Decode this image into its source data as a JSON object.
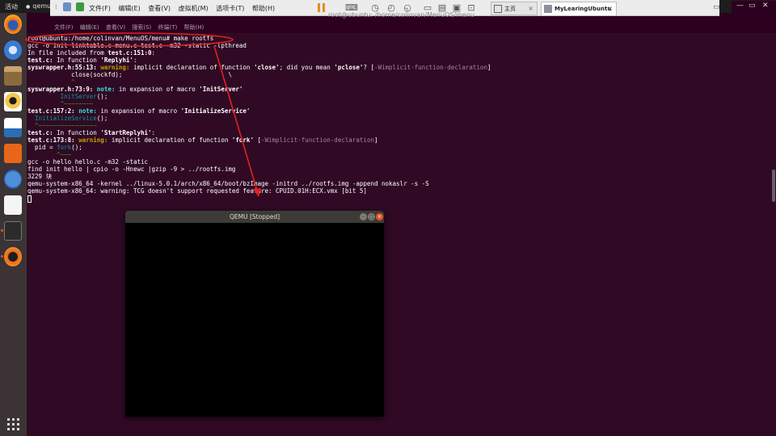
{
  "top_panel": {
    "activities": "活动",
    "app_name": "qemu-sy"
  },
  "vm_menu": {
    "items": [
      "文件(F)",
      "编辑(E)",
      "查看(V)",
      "虚拟机(M)",
      "选项卡(T)",
      "帮助(H)"
    ]
  },
  "tabs": [
    {
      "label": "主页"
    },
    {
      "label": "MyLearingUbuntu"
    }
  ],
  "terminal": {
    "title": "root@ubuntu: /home/colinvan/MenuOS/menu",
    "menu": [
      "文件(F)",
      "编辑(E)",
      "查看(V)",
      "搜索(S)",
      "终端(T)",
      "帮助(H)"
    ],
    "lines": [
      {
        "segs": [
          {
            "t": "root@ubuntu:/home/colinvan/MenuOS/menu# make rootfs"
          }
        ]
      },
      {
        "segs": [
          {
            "t": "gcc -o init linktable.c menu.c test.c -m32 -static -lpthread"
          }
        ]
      },
      {
        "segs": [
          {
            "t": "In file included from "
          },
          {
            "t": "test.c:151:0",
            "c": "b"
          },
          {
            "t": ":"
          }
        ]
      },
      {
        "segs": [
          {
            "t": "test.c:",
            "c": "b"
          },
          {
            "t": " In function "
          },
          {
            "t": "'Replyhi'",
            "c": "b"
          },
          {
            "t": ":"
          }
        ]
      },
      {
        "segs": [
          {
            "t": "syswrapper.h:55:13: ",
            "c": "b"
          },
          {
            "t": "warning: ",
            "c": "w"
          },
          {
            "t": "implicit declaration of function "
          },
          {
            "t": "'close'",
            "c": "b"
          },
          {
            "t": "; did you mean "
          },
          {
            "t": "'pclose'",
            "c": "b"
          },
          {
            "t": "? ["
          },
          {
            "t": "-Wimplicit-function-declaration",
            "c": "m"
          },
          {
            "t": "]"
          }
        ]
      },
      {
        "segs": [
          {
            "t": "            close(sockfd);                             \\"
          }
        ]
      },
      {
        "segs": [
          {
            "t": "            ^",
            "c": "g"
          }
        ]
      },
      {
        "segs": [
          {
            "t": "syswrapper.h:73:9: ",
            "c": "b"
          },
          {
            "t": "note: ",
            "c": "n"
          },
          {
            "t": "in expansion of macro "
          },
          {
            "t": "'InitServer'",
            "c": "b"
          }
        ]
      },
      {
        "segs": [
          {
            "t": "         "
          },
          {
            "t": "InitServer",
            "c": "c"
          },
          {
            "t": "();"
          }
        ]
      },
      {
        "segs": [
          {
            "t": "         ^~~~~~~~~",
            "c": "g"
          }
        ]
      },
      {
        "segs": [
          {
            "t": "test.c:157:2: ",
            "c": "b"
          },
          {
            "t": "note: ",
            "c": "n"
          },
          {
            "t": "in expansion of macro "
          },
          {
            "t": "'InitializeService'",
            "c": "b"
          }
        ]
      },
      {
        "segs": [
          {
            "t": "  "
          },
          {
            "t": "InitializeService",
            "c": "c"
          },
          {
            "t": "();"
          }
        ]
      },
      {
        "segs": [
          {
            "t": "  ^~~~~~~~~~~~~~~~~",
            "c": "g"
          }
        ]
      },
      {
        "segs": [
          {
            "t": "test.c:",
            "c": "b"
          },
          {
            "t": " In function "
          },
          {
            "t": "'StartReplyhi'",
            "c": "b"
          },
          {
            "t": ":"
          }
        ]
      },
      {
        "segs": [
          {
            "t": "test.c:173:8: ",
            "c": "b"
          },
          {
            "t": "warning: ",
            "c": "w"
          },
          {
            "t": "implicit declaration of function "
          },
          {
            "t": "'fork'",
            "c": "b"
          },
          {
            "t": " ["
          },
          {
            "t": "-Wimplicit-function-declaration",
            "c": "m"
          },
          {
            "t": "]"
          }
        ]
      },
      {
        "segs": [
          {
            "t": "  pid = "
          },
          {
            "t": "fork",
            "c": "c"
          },
          {
            "t": "();"
          }
        ]
      },
      {
        "segs": [
          {
            "t": "        ^~~~",
            "c": "g"
          }
        ]
      },
      {
        "segs": [
          {
            "t": "gcc -o hello hello.c -m32 -static"
          }
        ]
      },
      {
        "segs": [
          {
            "t": "find init hello | cpio -o -Hnewc |gzip -9 > ../rootfs.img"
          }
        ]
      },
      {
        "segs": [
          {
            "t": "3229 块"
          }
        ]
      },
      {
        "segs": [
          {
            "t": "qemu-system-x86_64 -kernel ../linux-5.0.1/arch/x86_64/boot/bzImage -initrd ../rootfs.img -append nokaslr -s -S"
          }
        ]
      },
      {
        "segs": [
          {
            "t": "qemu-system-x86_64: warning: TCG doesn't support requested feature: CPUID.01H:ECX.vmx [bit 5]"
          }
        ]
      }
    ]
  },
  "qemu_window": {
    "title": "QEMU [Stopped]"
  },
  "icons": {
    "launcher": [
      "firefox-icon",
      "thunderbird-icon",
      "files-icon",
      "rhythmbox-icon",
      "libreoffice-writer-icon",
      "software-center-icon",
      "help-icon",
      "amazon-icon",
      "terminal-icon",
      "qemu-icon"
    ]
  },
  "colors": {
    "terminal_bg": "#300a24",
    "annotation": "#e02020",
    "ubuntu_orange": "#e95420"
  }
}
